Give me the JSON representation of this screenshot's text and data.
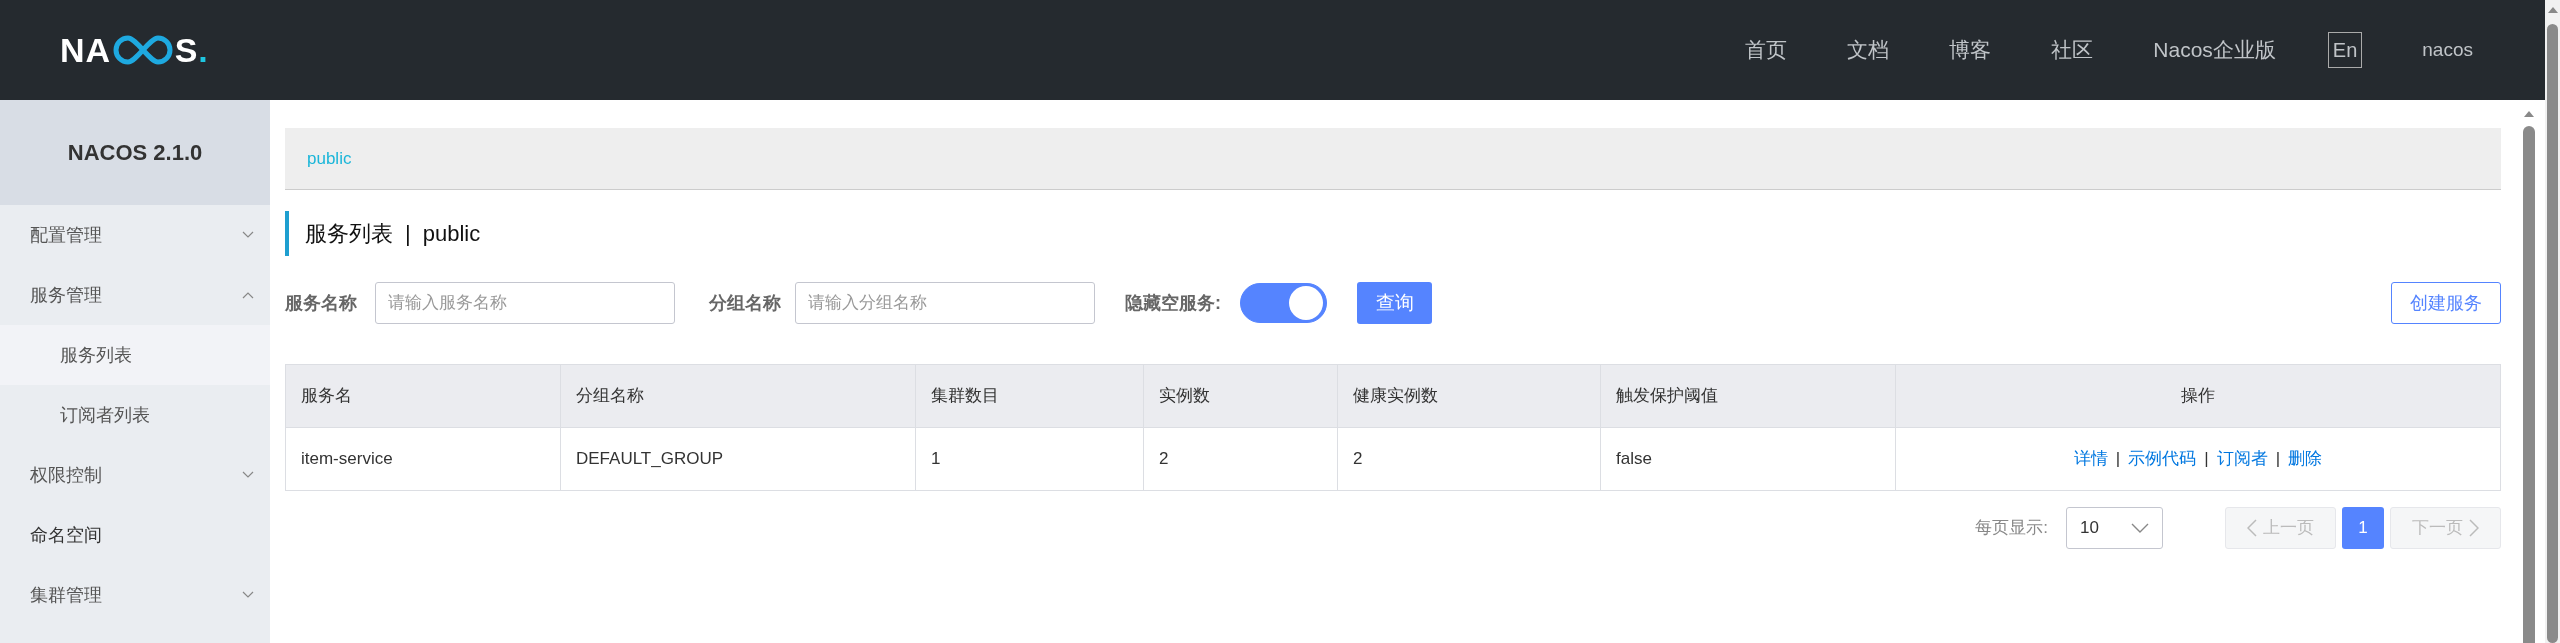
{
  "header": {
    "logo": {
      "prefix": "NA",
      "suffix": "S",
      "dot": "."
    },
    "nav": [
      "首页",
      "文档",
      "博客",
      "社区",
      "Nacos企业版"
    ],
    "language": "En",
    "user": "nacos"
  },
  "sidebar": {
    "title": "NACOS 2.1.0",
    "items": [
      {
        "kind": "group",
        "label": "配置管理",
        "expanded": false
      },
      {
        "kind": "group",
        "label": "服务管理",
        "expanded": true,
        "children": [
          {
            "label": "服务列表",
            "selected": true
          },
          {
            "label": "订阅者列表",
            "selected": false
          }
        ]
      },
      {
        "kind": "group",
        "label": "权限控制",
        "expanded": false
      },
      {
        "kind": "link",
        "label": "命名空间"
      },
      {
        "kind": "group",
        "label": "集群管理",
        "expanded": false
      }
    ]
  },
  "breadcrumb": "public",
  "page_title": {
    "title": "服务列表",
    "separator": "|",
    "namespace": "public"
  },
  "filters": {
    "service_name": {
      "label": "服务名称",
      "placeholder": "请输入服务名称"
    },
    "group_name": {
      "label": "分组名称",
      "placeholder": "请输入分组名称"
    },
    "hide_empty": {
      "label": "隐藏空服务:",
      "on": true
    },
    "query_button": "查询",
    "create_button": "创建服务"
  },
  "table": {
    "columns": [
      "服务名",
      "分组名称",
      "集群数目",
      "实例数",
      "健康实例数",
      "触发保护阈值",
      "操作"
    ],
    "rows": [
      {
        "cells": [
          "item-service",
          "DEFAULT_GROUP",
          "1",
          "2",
          "2",
          "false"
        ],
        "actions": [
          "详情",
          "示例代码",
          "订阅者",
          "删除"
        ],
        "action_separator": "|"
      }
    ]
  },
  "pagination": {
    "page_size_label": "每页显示:",
    "page_size": "10",
    "prev": "上一页",
    "next": "下一页",
    "pages": [
      {
        "label": "1",
        "selected": true
      }
    ]
  }
}
